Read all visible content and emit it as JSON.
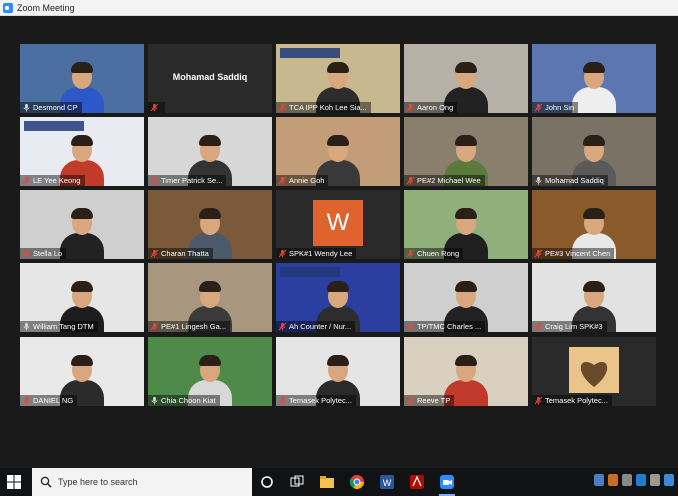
{
  "window": {
    "title": "Zoom Meeting"
  },
  "participants": [
    {
      "name": "Desmond CP",
      "muted": false,
      "bg": "#4a6fa0",
      "shirt": "#2e57c8"
    },
    {
      "name": "Mohamad Saddiq",
      "muted": true,
      "video_off": true
    },
    {
      "name": "TCA IPP Koh Lee Sia...",
      "muted": true,
      "bg": "#c8b890",
      "shirt": "#2d2d2d",
      "banner": "TOASTMASTERS INTERNATIONAL"
    },
    {
      "name": "Aaron Ong",
      "muted": true,
      "bg": "#b6b0a6",
      "shirt": "#222"
    },
    {
      "name": "John Sin",
      "muted": true,
      "bg": "#5b76b0",
      "shirt": "#eee"
    },
    {
      "name": "LE Yee Keong",
      "muted": true,
      "bg": "#e8ecf2",
      "shirt": "#c23b2a",
      "banner": "CHENG PANG TOASTMASTERS"
    },
    {
      "name": "Timer Patrick Se...",
      "muted": true,
      "bg": "#d7d7d7",
      "shirt": "#333"
    },
    {
      "name": "Annie Goh",
      "muted": true,
      "bg": "#c39c78",
      "shirt": "#3a3a3a"
    },
    {
      "name": "PE#2 Michael Wee",
      "muted": true,
      "bg": "#8a7e6c",
      "shirt": "#5b7a3b"
    },
    {
      "name": "Mohamad Saddiq",
      "muted": false,
      "bg": "#7b7266",
      "shirt": "#5a5a5a",
      "active": true
    },
    {
      "name": "Stella Lo",
      "muted": true,
      "bg": "#cfcfcf",
      "shirt": "#222"
    },
    {
      "name": "Charan Thatta",
      "muted": true,
      "bg": "#7a5a3a",
      "shirt": "#4a5a6a"
    },
    {
      "name": "SPK#1 Wendy Lee",
      "muted": true,
      "video_off": true,
      "initial": "W"
    },
    {
      "name": "Chuen Rong",
      "muted": true,
      "bg": "#8fb07a",
      "shirt": "#202020"
    },
    {
      "name": "PE#3 Vincent Chen",
      "muted": true,
      "bg": "#8a5a2a",
      "shirt": "#e8e8e8"
    },
    {
      "name": "William Tang DTM",
      "muted": false,
      "bg": "#e6e6e6",
      "shirt": "#1d1d1d"
    },
    {
      "name": "PE#1 Lingesh Ga...",
      "muted": true,
      "bg": "#a8967e",
      "shirt": "#3b3b3b"
    },
    {
      "name": "Ah Counter / Nur...",
      "muted": true,
      "bg": "#2b3fa0",
      "shirt": "#2d2d2d",
      "banner": "Tampines Changkat Advanced Toastmasters Club"
    },
    {
      "name": "TP/TMC Charles ...",
      "muted": true,
      "bg": "#cfcfcf",
      "shirt": "#222"
    },
    {
      "name": "Craig Lim SPK#3",
      "muted": true,
      "bg": "#e2e2e2",
      "shirt": "#333"
    },
    {
      "name": "DANIEL NG",
      "muted": true,
      "bg": "#e9e9e9",
      "shirt": "#2b2b2b"
    },
    {
      "name": "Chia Choon Kiat",
      "muted": false,
      "bg": "#4e8a4a",
      "shirt": "#d8d8d8"
    },
    {
      "name": "Temasek Polytec...",
      "muted": true,
      "bg": "#e5e5e5",
      "shirt": "#2a2a2a"
    },
    {
      "name": "Reeve TP",
      "muted": true,
      "bg": "#d9d0c0",
      "shirt": "#c0392b"
    },
    {
      "name": "Temasek Polytec...",
      "muted": true,
      "video_off": true,
      "art": true
    }
  ],
  "taskbar": {
    "search_placeholder": "Type here to search",
    "icons": [
      "windows-icon",
      "cortana-icon",
      "task-view-icon",
      "file-explorer-icon",
      "chrome-icon",
      "word-icon",
      "acrobat-icon",
      "zoom-icon"
    ]
  }
}
